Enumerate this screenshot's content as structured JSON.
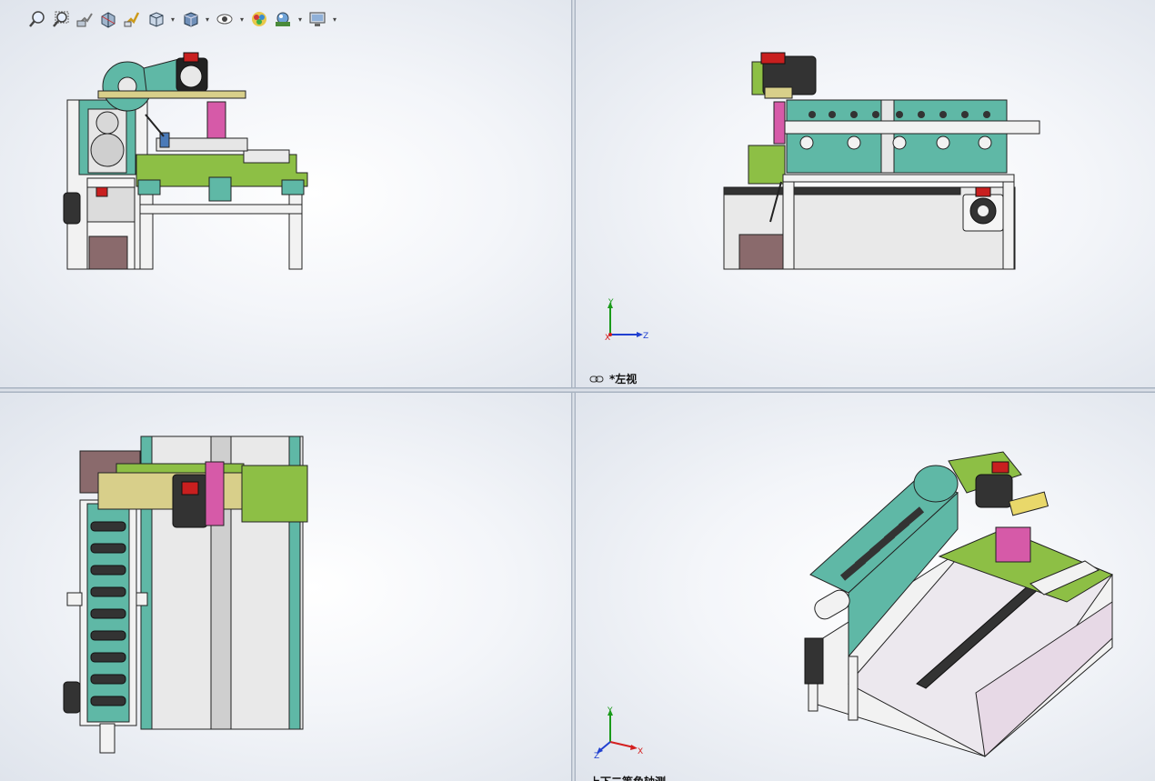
{
  "viewports": {
    "top_right": {
      "view_label": "*左视"
    },
    "bottom_right": {
      "view_label": "上下二等角轴测"
    }
  },
  "triad_axes": {
    "x": "X",
    "y": "Y",
    "z": "Z"
  },
  "toolbar_icons": [
    "zoom-to-fit-icon",
    "zoom-to-area-icon",
    "previous-view-icon",
    "section-view-icon",
    "dynamic-annotation-icon",
    "view-orientation-icon",
    "display-style-icon",
    "hide-show-items-icon",
    "edit-appearance-icon",
    "apply-scene-icon",
    "view-settings-icon"
  ],
  "colors": {
    "frame_teal": "#5fb8a6",
    "base_green": "#8dbf45",
    "motor_red": "#c81f1f",
    "guard_magenta": "#d65aa8",
    "panel_brown": "#8a6a6c",
    "axis_x": "#d42020",
    "axis_y": "#1a9a1a",
    "axis_z": "#2040d0"
  }
}
